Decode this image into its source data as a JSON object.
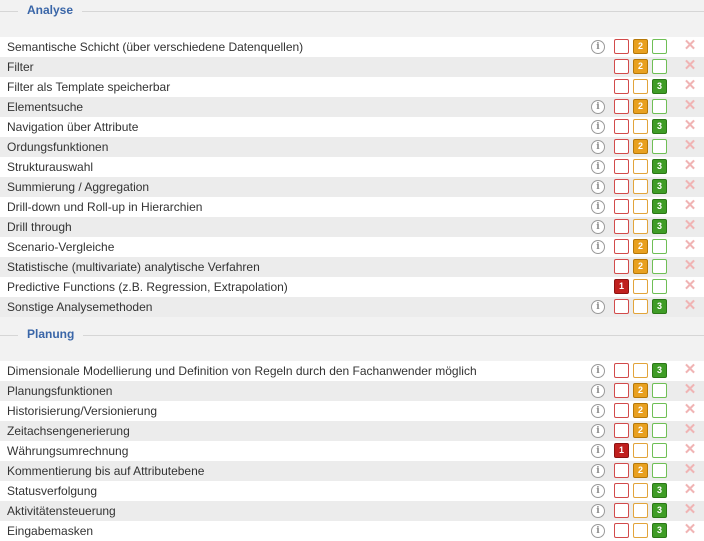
{
  "sections": [
    {
      "title": "Analyse",
      "rows": [
        {
          "label": "Semantische Schicht (über verschiedene Datenquellen)",
          "info": true,
          "selected": 2
        },
        {
          "label": "Filter",
          "info": false,
          "selected": 2
        },
        {
          "label": "Filter als Template speicherbar",
          "info": false,
          "selected": 3
        },
        {
          "label": "Elementsuche",
          "info": true,
          "selected": 2
        },
        {
          "label": "Navigation über Attribute",
          "info": true,
          "selected": 3
        },
        {
          "label": "Ordungsfunktionen",
          "info": true,
          "selected": 2
        },
        {
          "label": "Strukturauswahl",
          "info": true,
          "selected": 3
        },
        {
          "label": "Summierung / Aggregation",
          "info": true,
          "selected": 3
        },
        {
          "label": "Drill-down und Roll-up in Hierarchien",
          "info": true,
          "selected": 3
        },
        {
          "label": "Drill through",
          "info": true,
          "selected": 3
        },
        {
          "label": "Scenario-Vergleiche",
          "info": true,
          "selected": 2
        },
        {
          "label": "Statistische (multivariate) analytische Verfahren",
          "info": false,
          "selected": 2
        },
        {
          "label": "Predictive Functions (z.B. Regression, Extrapolation)",
          "info": false,
          "selected": 1
        },
        {
          "label": "Sonstige Analysemethoden",
          "info": true,
          "selected": 3
        }
      ]
    },
    {
      "title": "Planung",
      "rows": [
        {
          "label": "Dimensionale Modellierung und Definition von Regeln durch den Fachanwender möglich",
          "info": true,
          "selected": 3
        },
        {
          "label": "Planungsfunktionen",
          "info": true,
          "selected": 2
        },
        {
          "label": "Historisierung/Versionierung",
          "info": true,
          "selected": 2
        },
        {
          "label": "Zeitachsengenerierung",
          "info": true,
          "selected": 2
        },
        {
          "label": "Währungsumrechnung",
          "info": true,
          "selected": 1
        },
        {
          "label": "Kommentierung bis auf Attributebene",
          "info": true,
          "selected": 2
        },
        {
          "label": "Statusverfolgung",
          "info": true,
          "selected": 3
        },
        {
          "label": "Aktivitätensteuerung",
          "info": true,
          "selected": 3
        },
        {
          "label": "Eingabemasken",
          "info": true,
          "selected": 3
        }
      ]
    }
  ],
  "info_glyph": "i",
  "delete_glyph": "✕",
  "rating_labels": [
    "1",
    "2",
    "3"
  ],
  "icons": {
    "info": "info-icon",
    "delete": "delete-icon"
  },
  "colors": {
    "section_title": "#3a66a8",
    "rating_1": "#c0201e",
    "rating_2": "#e8a020",
    "rating_3": "#3f9c26",
    "delete": "#f0b4b4"
  }
}
